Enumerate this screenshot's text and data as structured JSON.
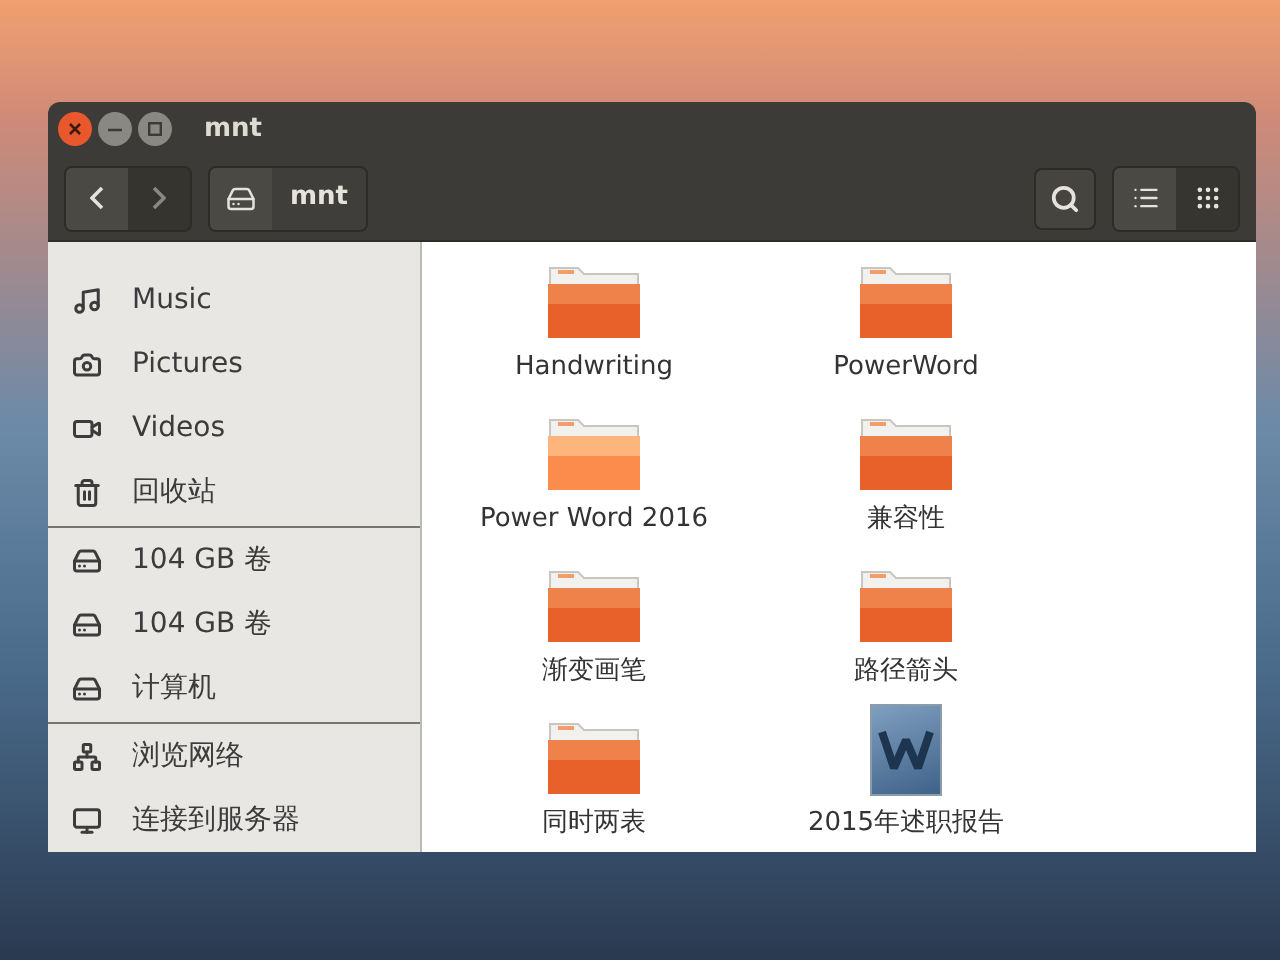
{
  "window": {
    "title": "mnt"
  },
  "toolbar": {
    "nav": [
      {
        "kind": "back",
        "disabled": false
      },
      {
        "kind": "forward",
        "disabled": true
      }
    ],
    "path": [
      {
        "kind": "drive-icon"
      },
      {
        "kind": "text",
        "label": "mnt"
      }
    ],
    "views": [
      {
        "kind": "list",
        "selected": false
      },
      {
        "kind": "grid",
        "selected": true
      }
    ]
  },
  "sidebar": {
    "sections": [
      [
        {
          "kind": "music",
          "label": "Music"
        },
        {
          "kind": "pictures",
          "label": "Pictures"
        },
        {
          "kind": "videos",
          "label": "Videos"
        },
        {
          "kind": "trash",
          "label": "回收站"
        }
      ],
      [
        {
          "kind": "drive",
          "label": "104 GB 卷"
        },
        {
          "kind": "drive",
          "label": "104 GB 卷"
        },
        {
          "kind": "drive",
          "label": "计算机"
        }
      ],
      [
        {
          "kind": "network",
          "label": "浏览网络"
        },
        {
          "kind": "server",
          "label": "连接到服务器"
        }
      ]
    ]
  },
  "files": [
    {
      "kind": "folder",
      "name": "Handwriting",
      "selected": false
    },
    {
      "kind": "folder",
      "name": "PowerWord",
      "selected": false
    },
    {
      "kind": "folder",
      "name": "Power Word 2016",
      "selected": true
    },
    {
      "kind": "folder",
      "name": "兼容性",
      "selected": false
    },
    {
      "kind": "folder",
      "name": "渐变画笔",
      "selected": false
    },
    {
      "kind": "folder",
      "name": "路径箭头",
      "selected": false
    },
    {
      "kind": "folder",
      "name": "同时两表",
      "selected": false
    },
    {
      "kind": "document",
      "name": "2015年述职报告",
      "selected": false
    }
  ]
}
